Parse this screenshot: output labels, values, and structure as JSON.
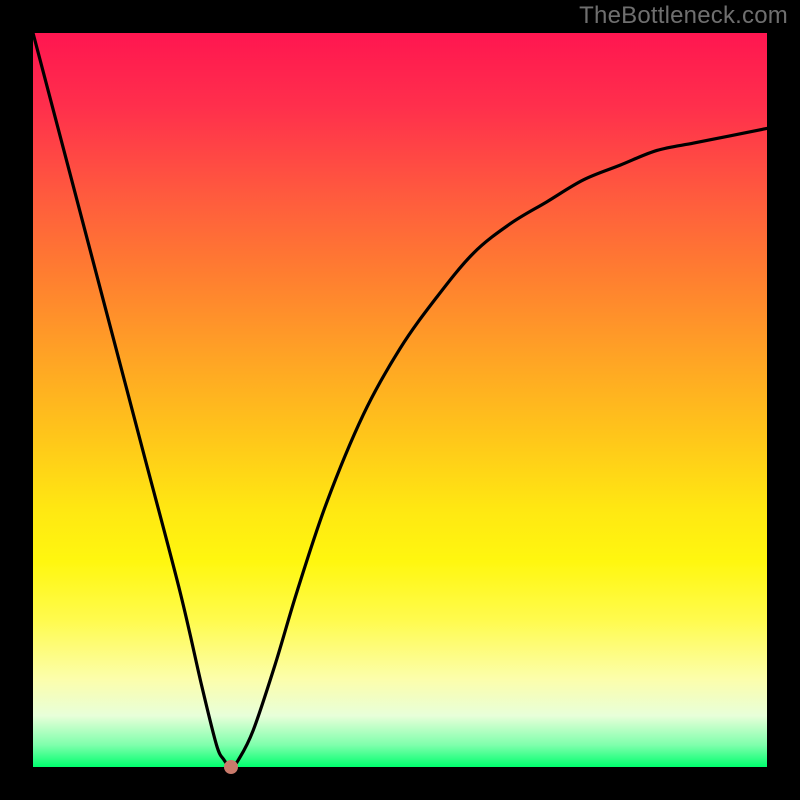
{
  "watermark": "TheBottleneck.com",
  "chart_data": {
    "type": "line",
    "title": "",
    "xlabel": "",
    "ylabel": "",
    "xlim": [
      0,
      100
    ],
    "ylim": [
      0,
      100
    ],
    "grid": false,
    "series": [
      {
        "name": "bottleneck-curve",
        "x": [
          0,
          5,
          10,
          15,
          20,
          23,
          25,
          26,
          27,
          28,
          30,
          33,
          36,
          40,
          45,
          50,
          55,
          60,
          65,
          70,
          75,
          80,
          85,
          90,
          95,
          100
        ],
        "values": [
          100,
          81,
          62,
          43,
          24,
          11,
          3,
          1,
          0,
          1,
          5,
          14,
          24,
          36,
          48,
          57,
          64,
          70,
          74,
          77,
          80,
          82,
          84,
          85,
          86,
          87
        ]
      }
    ],
    "marker": {
      "x": 27,
      "y": 0
    },
    "background_gradient": {
      "direction": "vertical",
      "stops": [
        {
          "pos": 0.0,
          "color": "#ff1650"
        },
        {
          "pos": 0.5,
          "color": "#ffc21c"
        },
        {
          "pos": 0.8,
          "color": "#fffb4e"
        },
        {
          "pos": 1.0,
          "color": "#00ff6e"
        }
      ]
    }
  }
}
